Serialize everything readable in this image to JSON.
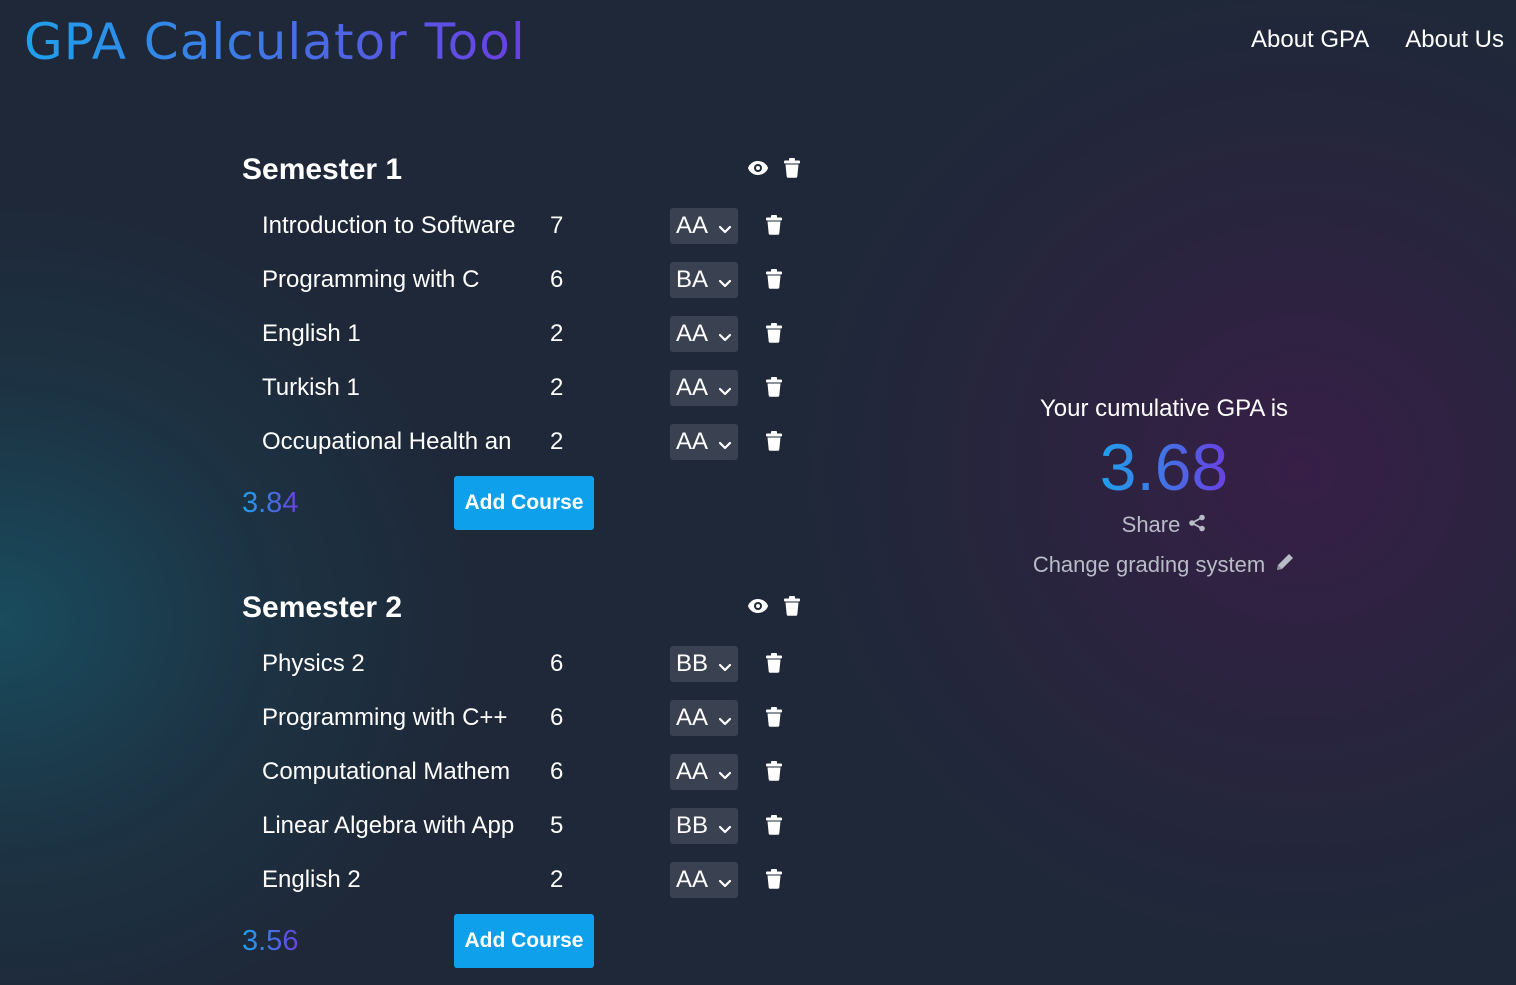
{
  "app": {
    "title": "GPA Calculator Tool"
  },
  "nav": {
    "items": [
      {
        "label": "About GPA"
      },
      {
        "label": "About Us"
      }
    ]
  },
  "semesters": [
    {
      "title": "Semester 1",
      "courses": [
        {
          "name": "Introduction to Software",
          "credit": "7",
          "grade": "AA"
        },
        {
          "name": "Programming with C",
          "credit": "6",
          "grade": "BA"
        },
        {
          "name": "English 1",
          "credit": "2",
          "grade": "AA"
        },
        {
          "name": "Turkish 1",
          "credit": "2",
          "grade": "AA"
        },
        {
          "name": "Occupational Health an",
          "credit": "2",
          "grade": "AA"
        }
      ],
      "gpa": "3.84",
      "add_label": "Add Course"
    },
    {
      "title": "Semester 2",
      "courses": [
        {
          "name": "Physics 2",
          "credit": "6",
          "grade": "BB"
        },
        {
          "name": "Programming with C++",
          "credit": "6",
          "grade": "AA"
        },
        {
          "name": "Computational Mathem",
          "credit": "6",
          "grade": "AA"
        },
        {
          "name": "Linear Algebra with App",
          "credit": "5",
          "grade": "BB"
        },
        {
          "name": "English 2",
          "credit": "2",
          "grade": "AA"
        }
      ],
      "gpa": "3.56",
      "add_label": "Add Course"
    }
  ],
  "summary": {
    "label": "Your cumulative GPA is",
    "gpa": "3.68",
    "share_label": "Share",
    "change_grading_label": "Change grading system"
  },
  "icons": {
    "eye": "eye-icon",
    "trash": "trash-icon",
    "chevron": "chevron-down-icon",
    "share": "share-icon",
    "pencil": "pencil-icon"
  },
  "colors": {
    "background": "#1e2838",
    "accent_blue": "#0ea0ea",
    "gradient_start": "#1fa0ec",
    "gradient_end": "#6a3fe2",
    "select_bg": "#3a4150",
    "muted_text": "#b8bcc6"
  }
}
